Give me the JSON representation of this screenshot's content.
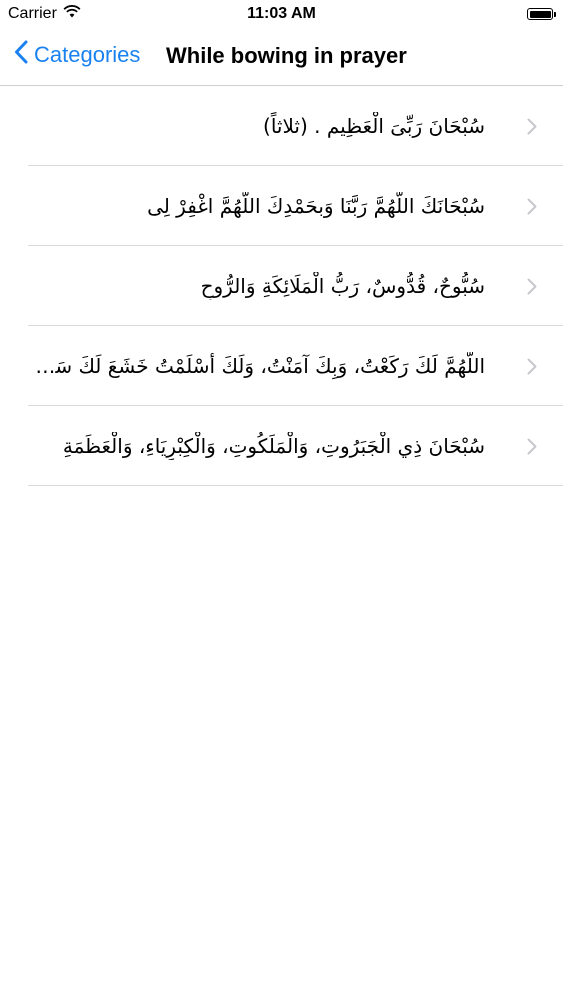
{
  "status_bar": {
    "carrier": "Carrier",
    "time": "11:03 AM"
  },
  "nav": {
    "back_label": "Categories",
    "title": "While bowing in prayer"
  },
  "items": [
    {
      "text": "سُبْحَانَ رَبِّیَ الْعَظِیم . (ثلاثاً)"
    },
    {
      "text": "سُبْحَانَكَ اللّهُمَّ رَبَّنَا وَبحَمْدِكَ اللّهُمَّ اغْفِرْ لِی"
    },
    {
      "text": "سُبُّوحٌ، قُدُّوسٌ، رَبُّ الْمَلَائِكَةِ وَالرُّوحِ"
    },
    {
      "text": "اللّهُمَّ لَكَ رَكَعْتُ، وَبِكَ آمَنْتُ، وَلَكَ أَسْلَمْتُ خَشَعَ لَكَ سَمْعی..."
    },
    {
      "text": "سُبْحَانَ ذِي الْجَبَرُوتِ، وَالْمَلَكُوتِ، وَالْكِبْرِيَاءِ، وَالْعَظَمَةِ"
    }
  ],
  "icons": {
    "back": "chevron-left-icon",
    "disclosure": "chevron-right-icon",
    "wifi": "wifi-icon",
    "battery": "battery-icon"
  },
  "colors": {
    "accent": "#1a82f0",
    "separator": "#dadadd",
    "chevron": "#c7c7cc"
  }
}
